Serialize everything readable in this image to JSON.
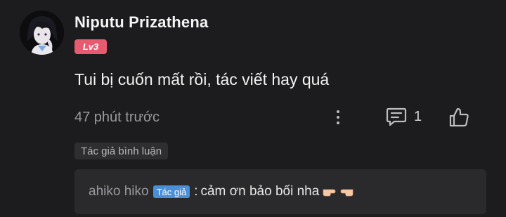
{
  "comment": {
    "username": "Niputu Prizathena",
    "level": "Lv3",
    "text": "Tui bị cuốn mất rồi, tác viết hay quá",
    "timestamp": "47 phút trước",
    "reply_count": "1",
    "author_tag": "Tác giả bình luận"
  },
  "reply": {
    "author": "ahiko hiko",
    "badge": "Tác giả",
    "separator": ":",
    "text": "cảm ơn bảo bối nha"
  },
  "icons": {
    "more": "more-vertical-icon",
    "reply": "comment-icon",
    "like": "thumbs-up-icon",
    "emoji": "pointing-hands-emoji"
  },
  "colors": {
    "background": "#1c1c1e",
    "level_badge": "#e85a70",
    "author_badge": "#4a8fd8",
    "reply_box": "#2a2a2d"
  }
}
